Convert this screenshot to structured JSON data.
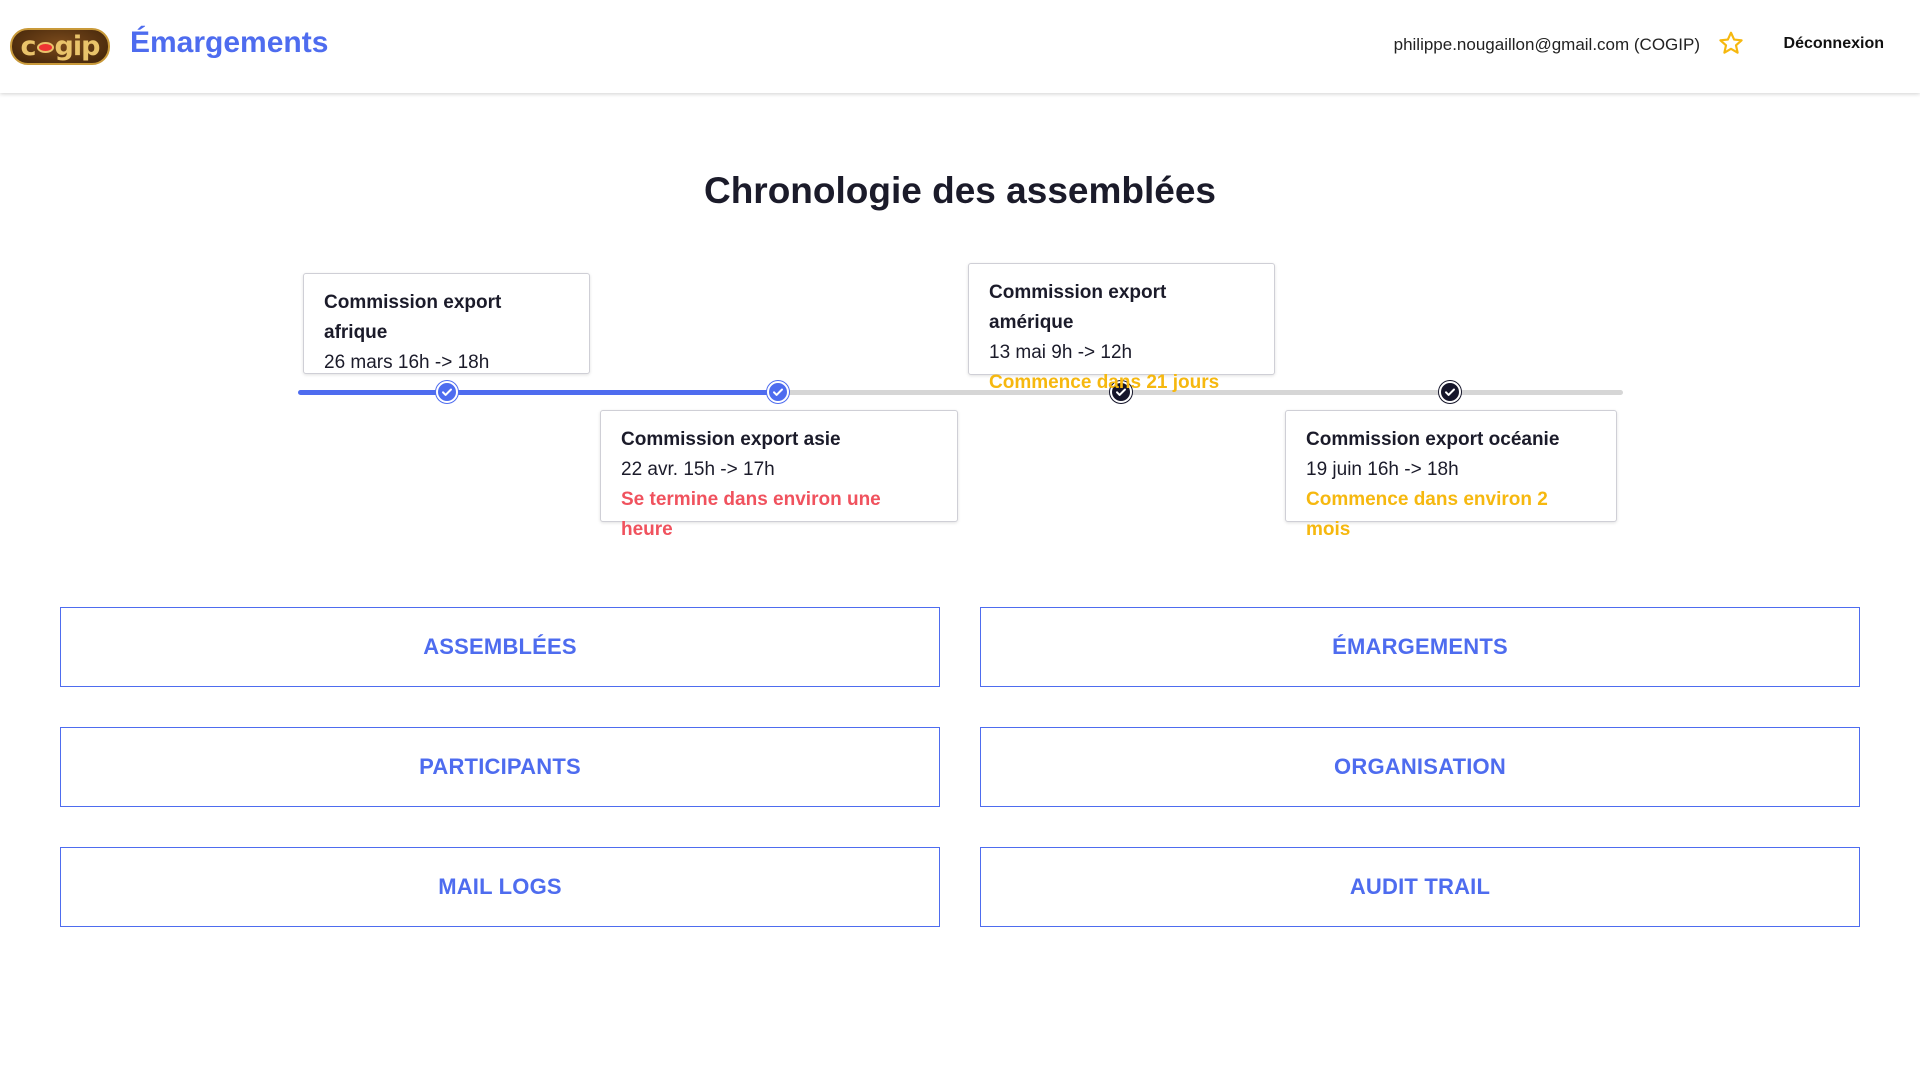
{
  "header": {
    "logo_text": "cogip",
    "app_title": "Émargements",
    "user_email": "philippe.nougaillon@gmail.com (COGIP)",
    "logout_label": "Déconnexion"
  },
  "main": {
    "title": "Chronologie des assemblées"
  },
  "timeline": {
    "events": [
      {
        "name": "Commission export afrique",
        "date": "26 mars 16h -> 18h",
        "status": "",
        "status_color": "",
        "state": "done"
      },
      {
        "name": "Commission export asie",
        "date": "22 avr. 15h -> 17h",
        "status": "Se termine dans environ une heure",
        "status_color": "#f0525e",
        "state": "done"
      },
      {
        "name": "Commission export amérique",
        "date": "13 mai 9h -> 12h",
        "status": "Commence dans 21 jours",
        "status_color": "#f6b80f",
        "state": "upcoming"
      },
      {
        "name": "Commission export océanie",
        "date": "19 juin 16h -> 18h",
        "status": "Commence dans environ 2 mois",
        "status_color": "#f6b80f",
        "state": "upcoming"
      }
    ]
  },
  "nav": {
    "assemblees": "ASSEMBLÉES",
    "emargements": "ÉMARGEMENTS",
    "participants": "PARTICIPANTS",
    "organisation": "ORGANISATION",
    "mail_logs": "MAIL LOGS",
    "audit_trail": "AUDIT TRAIL"
  },
  "colors": {
    "accent": "#4e6cef",
    "warning": "#f6b80f",
    "danger": "#f0525e",
    "dark": "#15152a"
  }
}
